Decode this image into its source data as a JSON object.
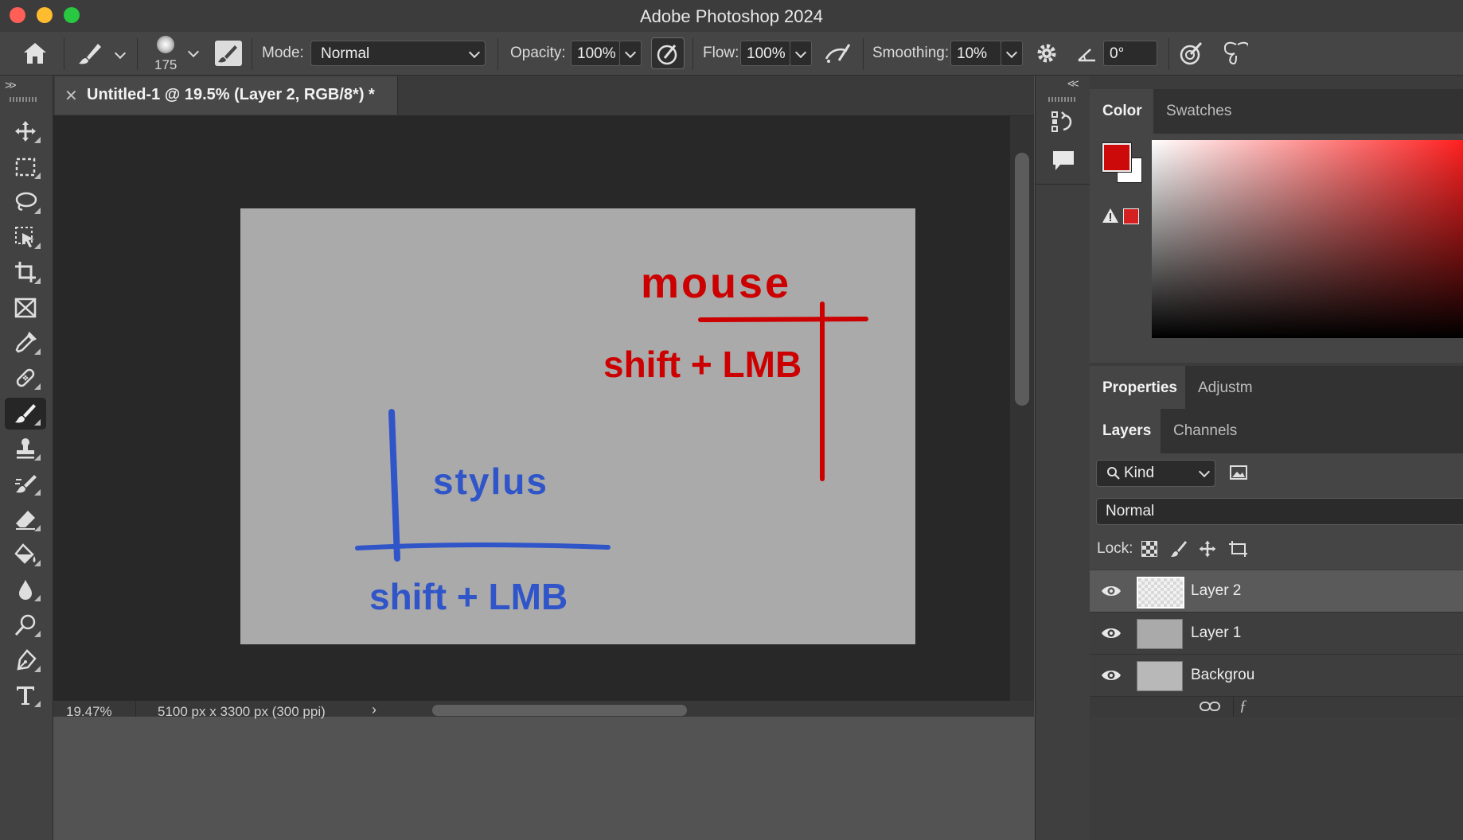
{
  "window": {
    "title": "Adobe Photoshop 2024"
  },
  "options_bar": {
    "brush_size": "175",
    "mode_label": "Mode:",
    "mode_value": "Normal",
    "opacity_label": "Opacity:",
    "opacity_value": "100%",
    "flow_label": "Flow:",
    "flow_value": "100%",
    "smoothing_label": "Smoothing:",
    "smoothing_value": "10%",
    "angle_value": "0°"
  },
  "document": {
    "tab_title": "Untitled-1 @ 19.5% (Layer 2, RGB/8*) *",
    "zoom": "19.47%",
    "size_info": "5100 px x 3300 px (300 ppi)",
    "canvas_bg": "#aaaaaa",
    "annotations": {
      "mouse_word": "mouse",
      "mouse_shortcut": "shift + LMB",
      "stylus_word": "stylus",
      "stylus_shortcut": "shift + LMB",
      "mouse_color": "#cc0000",
      "stylus_color": "#2f55c9"
    }
  },
  "color_panel": {
    "tabs": [
      "Color",
      "Swatches"
    ],
    "foreground": "#cc0a0a",
    "background": "#ffffff"
  },
  "properties_tabs": [
    "Properties",
    "Adjustm"
  ],
  "layers_panel": {
    "tabs": [
      "Layers",
      "Channels"
    ],
    "filter_label": "Kind",
    "blend_mode": "Normal",
    "lock_label": "Lock:",
    "layers": [
      {
        "name": "Layer 2",
        "selected": true
      },
      {
        "name": "Layer 1",
        "selected": false
      },
      {
        "name": "Backgrou",
        "selected": false
      }
    ]
  },
  "icons": {
    "tools": [
      "move-icon",
      "marquee-icon",
      "lasso-icon",
      "object-select-icon",
      "crop-icon",
      "frame-icon",
      "eyedropper-icon",
      "healing-icon",
      "brush-icon",
      "stamp-icon",
      "history-brush-icon",
      "eraser-icon",
      "paint-bucket-icon",
      "blur-icon",
      "dodge-icon",
      "pen-icon",
      "type-icon"
    ]
  }
}
